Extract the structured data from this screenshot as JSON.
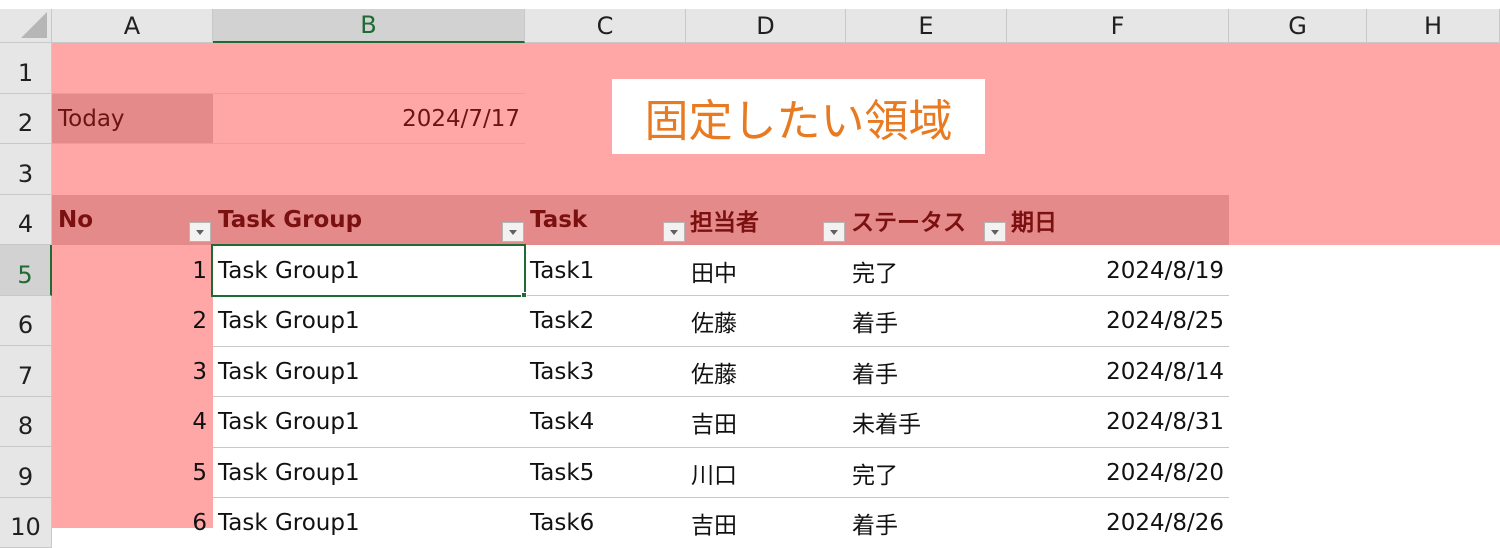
{
  "columns": [
    "A",
    "B",
    "C",
    "D",
    "E",
    "F",
    "G",
    "H"
  ],
  "rows": [
    "1",
    "2",
    "3",
    "4",
    "5",
    "6",
    "7",
    "8",
    "9",
    "10"
  ],
  "today_label": "Today",
  "today_value": "2024/7/17",
  "callout": "固定したい領域",
  "table_headers": [
    "No",
    "Task Group",
    "Task",
    "担当者",
    "ステータス",
    "期日"
  ],
  "table_rows": [
    {
      "no": "1",
      "group": "Task Group1",
      "task": "Task1",
      "owner": "田中",
      "status": "完了",
      "due": "2024/8/19"
    },
    {
      "no": "2",
      "group": "Task Group1",
      "task": "Task2",
      "owner": "佐藤",
      "status": "着手",
      "due": "2024/8/25"
    },
    {
      "no": "3",
      "group": "Task Group1",
      "task": "Task3",
      "owner": "佐藤",
      "status": "着手",
      "due": "2024/8/14"
    },
    {
      "no": "4",
      "group": "Task Group1",
      "task": "Task4",
      "owner": "吉田",
      "status": "未着手",
      "due": "2024/8/31"
    },
    {
      "no": "5",
      "group": "Task Group1",
      "task": "Task5",
      "owner": "川口",
      "status": "完了",
      "due": "2024/8/20"
    },
    {
      "no": "6",
      "group": "Task Group1",
      "task": "Task6",
      "owner": "吉田",
      "status": "着手",
      "due": "2024/8/26"
    }
  ],
  "colors": {
    "freeze_area": "#ffa6a6",
    "header_band": "#e58a8a",
    "callout_text": "#e87a22",
    "selection": "#1e6b34"
  },
  "active_cell": "B5"
}
